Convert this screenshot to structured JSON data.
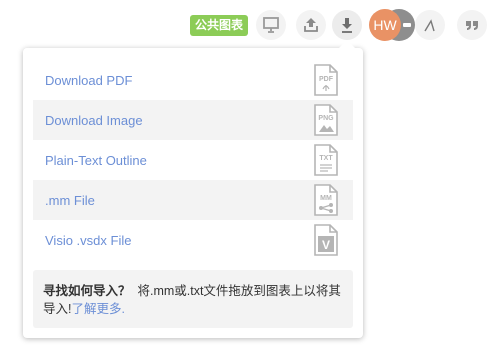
{
  "toolbar": {
    "public_badge": "公共图表",
    "avatar_initials": "HW",
    "icons": [
      "present-icon",
      "upload-icon",
      "download-icon",
      "line-tool-icon",
      "quote-icon"
    ],
    "colors": {
      "badge": "#8ccc57",
      "avatar": "#e99265"
    }
  },
  "export_menu": {
    "items": [
      {
        "label": "Download PDF",
        "icon": "pdf-file-icon",
        "icon_text": "PDF"
      },
      {
        "label": "Download Image",
        "icon": "png-file-icon",
        "icon_text": "PNG"
      },
      {
        "label": "Plain-Text Outline",
        "icon": "txt-file-icon",
        "icon_text": "TXT"
      },
      {
        "label": ".mm File",
        "icon": "mm-file-icon",
        "icon_text": "MM"
      },
      {
        "label": "Visio .vsdx File",
        "icon": "visio-file-icon",
        "icon_text": "V"
      }
    ],
    "help": {
      "title": "寻找如何导入？",
      "body": "将.mm或.txt文件拖放到图表上以将其导入!",
      "link": "了解更多."
    },
    "link_color": "#6c8fd6"
  }
}
